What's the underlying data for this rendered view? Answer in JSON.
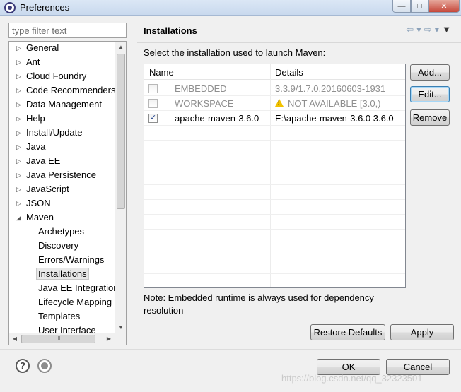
{
  "window": {
    "title": "Preferences",
    "controls": {
      "minimize": "—",
      "maximize": "□",
      "close": "✕"
    }
  },
  "sidebar": {
    "filter_placeholder": "type filter text",
    "items": [
      {
        "label": "General",
        "expandable": true
      },
      {
        "label": "Ant",
        "expandable": true
      },
      {
        "label": "Cloud Foundry",
        "expandable": true
      },
      {
        "label": "Code Recommenders",
        "expandable": true
      },
      {
        "label": "Data Management",
        "expandable": true
      },
      {
        "label": "Help",
        "expandable": true
      },
      {
        "label": "Install/Update",
        "expandable": true
      },
      {
        "label": "Java",
        "expandable": true
      },
      {
        "label": "Java EE",
        "expandable": true
      },
      {
        "label": "Java Persistence",
        "expandable": true
      },
      {
        "label": "JavaScript",
        "expandable": true
      },
      {
        "label": "JSON",
        "expandable": true
      },
      {
        "label": "Maven",
        "expandable": true,
        "expanded": true
      }
    ],
    "maven_children": [
      "Archetypes",
      "Discovery",
      "Errors/Warnings",
      "Installations",
      "Java EE Integration",
      "Lifecycle Mapping",
      "Templates",
      "User Interface"
    ],
    "selected": "Installations",
    "hscroll_grip": "III"
  },
  "page": {
    "title": "Installations",
    "nav": {
      "back": "⇦",
      "forward": "⇨",
      "dropdown": "▾",
      "menu": "▼"
    },
    "instruction": "Select the installation used to launch Maven:",
    "columns": [
      "Name",
      "Details"
    ],
    "rows": [
      {
        "checked": false,
        "enabled": false,
        "name": "EMBEDDED",
        "details": "3.3.9/1.7.0.20160603-1931",
        "warning": false
      },
      {
        "checked": false,
        "enabled": false,
        "name": "WORKSPACE",
        "details": "NOT AVAILABLE [3.0,)",
        "warning": true
      },
      {
        "checked": true,
        "enabled": true,
        "name": "apache-maven-3.6.0",
        "details": "E:\\apache-maven-3.6.0 3.6.0",
        "warning": false
      }
    ],
    "buttons": {
      "add": "Add...",
      "edit": "Edit...",
      "remove": "Remove"
    },
    "note": "Note: Embedded runtime is always used for dependency resolution",
    "restore_defaults": "Restore Defaults",
    "apply": "Apply"
  },
  "footer": {
    "ok": "OK",
    "cancel": "Cancel",
    "help_glyph": "?",
    "watermark": "https://blog.csdn.net/qq_32323501"
  },
  "colors": {
    "warning": "#f2c200",
    "disabled_text": "#8f8f8f",
    "focus_border": "#3c7fb1"
  }
}
